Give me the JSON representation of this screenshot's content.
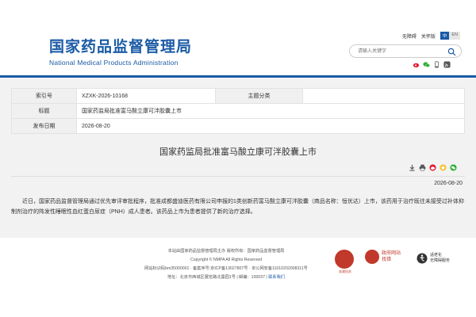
{
  "header": {
    "logo_cn": "国家药品监督管理局",
    "logo_en": "National Medical Products Administration",
    "links": [
      "无障碍",
      "关怀版"
    ],
    "lang_cn": "中",
    "lang_en": "EN",
    "search_placeholder": "请输入关键字"
  },
  "social_icons": [
    "weibo-icon",
    "wechat-icon",
    "mobile-icon",
    "rss-icon"
  ],
  "meta": {
    "rows": [
      {
        "label": "索引号",
        "value": "XZXK-2026-10168",
        "label2": "主题分类",
        "value2": ""
      },
      {
        "label": "标题",
        "value": "国家药监局批准富马酸立康可泮胶囊上市"
      },
      {
        "label": "发布日期",
        "value": "2026-08-20"
      }
    ]
  },
  "article": {
    "title": "国家药监局批准富马酸立康可泮胶囊上市",
    "date": "2026-08-20",
    "body": "近日，国家药品监督管理局通过优先审评审批程序，批准成都盛迪医药有限公司申报的1类创新药富马酸立康可泮胶囊（商品名称：恒优达）上市，该药用于治疗既往未接受过补体抑制剂治疗的阵发性睡眠性血红蛋白尿症（PNH）成人患者。该药品上市为患者提供了新的治疗选择。"
  },
  "footer": {
    "line1": "本站由国家药品监督管理局主办 版权所有：国家药品监督管理局",
    "line2": "Copyright © NMPA All Rights Reserved",
    "line3": "网站标识码bm35000001 · 备案序号:京ICP备13027807号 · 京公网安备11010202008311号",
    "line4": "地址：北京市西城区展览路北露园1号 | 邮编：100037 |",
    "contact": "联系我们",
    "badge1": "党政机关",
    "badge2_title": "政府网站",
    "badge2_sub": "找错",
    "badge3_title": "适老化",
    "badge3_sub": "无障碍服务"
  },
  "colors": {
    "brand": "#1a5aa6",
    "accent_red": "#c0392b"
  }
}
